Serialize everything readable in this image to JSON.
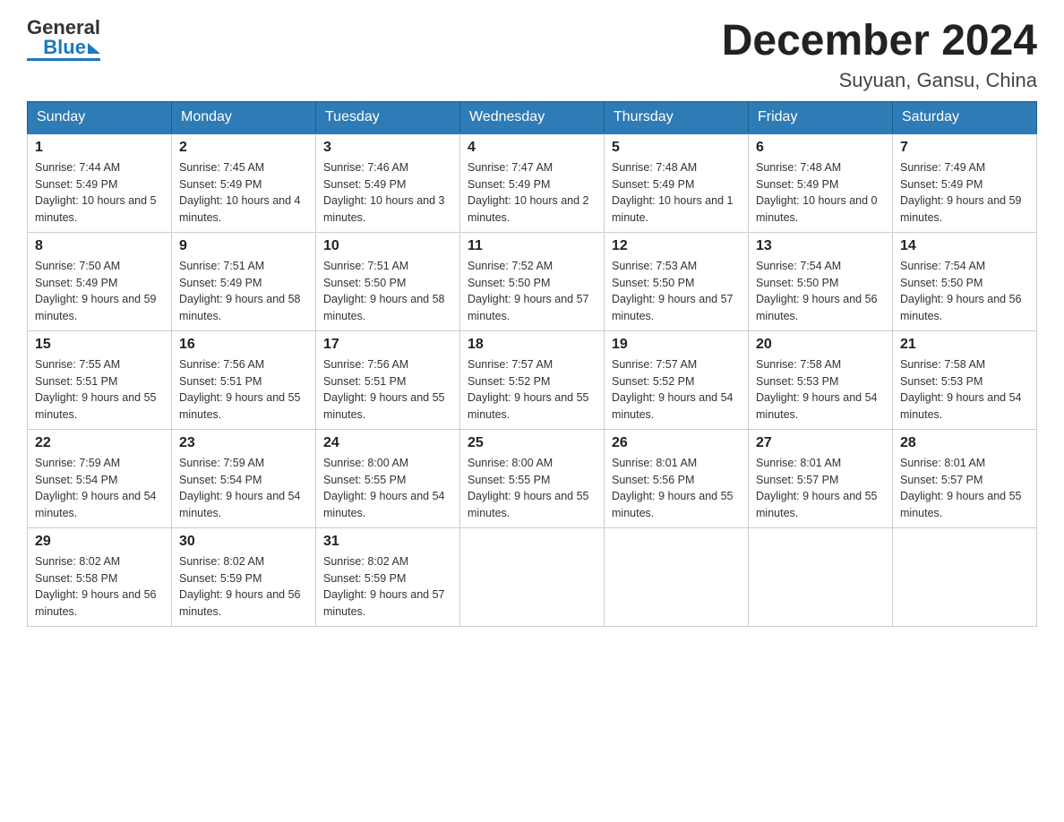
{
  "header": {
    "title": "December 2024",
    "subtitle": "Suyuan, Gansu, China",
    "logo_general": "General",
    "logo_blue": "Blue"
  },
  "days_of_week": [
    "Sunday",
    "Monday",
    "Tuesday",
    "Wednesday",
    "Thursday",
    "Friday",
    "Saturday"
  ],
  "weeks": [
    [
      {
        "day": "1",
        "sunrise": "7:44 AM",
        "sunset": "5:49 PM",
        "daylight": "10 hours and 5 minutes."
      },
      {
        "day": "2",
        "sunrise": "7:45 AM",
        "sunset": "5:49 PM",
        "daylight": "10 hours and 4 minutes."
      },
      {
        "day": "3",
        "sunrise": "7:46 AM",
        "sunset": "5:49 PM",
        "daylight": "10 hours and 3 minutes."
      },
      {
        "day": "4",
        "sunrise": "7:47 AM",
        "sunset": "5:49 PM",
        "daylight": "10 hours and 2 minutes."
      },
      {
        "day": "5",
        "sunrise": "7:48 AM",
        "sunset": "5:49 PM",
        "daylight": "10 hours and 1 minute."
      },
      {
        "day": "6",
        "sunrise": "7:48 AM",
        "sunset": "5:49 PM",
        "daylight": "10 hours and 0 minutes."
      },
      {
        "day": "7",
        "sunrise": "7:49 AM",
        "sunset": "5:49 PM",
        "daylight": "9 hours and 59 minutes."
      }
    ],
    [
      {
        "day": "8",
        "sunrise": "7:50 AM",
        "sunset": "5:49 PM",
        "daylight": "9 hours and 59 minutes."
      },
      {
        "day": "9",
        "sunrise": "7:51 AM",
        "sunset": "5:49 PM",
        "daylight": "9 hours and 58 minutes."
      },
      {
        "day": "10",
        "sunrise": "7:51 AM",
        "sunset": "5:50 PM",
        "daylight": "9 hours and 58 minutes."
      },
      {
        "day": "11",
        "sunrise": "7:52 AM",
        "sunset": "5:50 PM",
        "daylight": "9 hours and 57 minutes."
      },
      {
        "day": "12",
        "sunrise": "7:53 AM",
        "sunset": "5:50 PM",
        "daylight": "9 hours and 57 minutes."
      },
      {
        "day": "13",
        "sunrise": "7:54 AM",
        "sunset": "5:50 PM",
        "daylight": "9 hours and 56 minutes."
      },
      {
        "day": "14",
        "sunrise": "7:54 AM",
        "sunset": "5:50 PM",
        "daylight": "9 hours and 56 minutes."
      }
    ],
    [
      {
        "day": "15",
        "sunrise": "7:55 AM",
        "sunset": "5:51 PM",
        "daylight": "9 hours and 55 minutes."
      },
      {
        "day": "16",
        "sunrise": "7:56 AM",
        "sunset": "5:51 PM",
        "daylight": "9 hours and 55 minutes."
      },
      {
        "day": "17",
        "sunrise": "7:56 AM",
        "sunset": "5:51 PM",
        "daylight": "9 hours and 55 minutes."
      },
      {
        "day": "18",
        "sunrise": "7:57 AM",
        "sunset": "5:52 PM",
        "daylight": "9 hours and 55 minutes."
      },
      {
        "day": "19",
        "sunrise": "7:57 AM",
        "sunset": "5:52 PM",
        "daylight": "9 hours and 54 minutes."
      },
      {
        "day": "20",
        "sunrise": "7:58 AM",
        "sunset": "5:53 PM",
        "daylight": "9 hours and 54 minutes."
      },
      {
        "day": "21",
        "sunrise": "7:58 AM",
        "sunset": "5:53 PM",
        "daylight": "9 hours and 54 minutes."
      }
    ],
    [
      {
        "day": "22",
        "sunrise": "7:59 AM",
        "sunset": "5:54 PM",
        "daylight": "9 hours and 54 minutes."
      },
      {
        "day": "23",
        "sunrise": "7:59 AM",
        "sunset": "5:54 PM",
        "daylight": "9 hours and 54 minutes."
      },
      {
        "day": "24",
        "sunrise": "8:00 AM",
        "sunset": "5:55 PM",
        "daylight": "9 hours and 54 minutes."
      },
      {
        "day": "25",
        "sunrise": "8:00 AM",
        "sunset": "5:55 PM",
        "daylight": "9 hours and 55 minutes."
      },
      {
        "day": "26",
        "sunrise": "8:01 AM",
        "sunset": "5:56 PM",
        "daylight": "9 hours and 55 minutes."
      },
      {
        "day": "27",
        "sunrise": "8:01 AM",
        "sunset": "5:57 PM",
        "daylight": "9 hours and 55 minutes."
      },
      {
        "day": "28",
        "sunrise": "8:01 AM",
        "sunset": "5:57 PM",
        "daylight": "9 hours and 55 minutes."
      }
    ],
    [
      {
        "day": "29",
        "sunrise": "8:02 AM",
        "sunset": "5:58 PM",
        "daylight": "9 hours and 56 minutes."
      },
      {
        "day": "30",
        "sunrise": "8:02 AM",
        "sunset": "5:59 PM",
        "daylight": "9 hours and 56 minutes."
      },
      {
        "day": "31",
        "sunrise": "8:02 AM",
        "sunset": "5:59 PM",
        "daylight": "9 hours and 57 minutes."
      },
      null,
      null,
      null,
      null
    ]
  ],
  "sunrise_label": "Sunrise:",
  "sunset_label": "Sunset:",
  "daylight_label": "Daylight:"
}
